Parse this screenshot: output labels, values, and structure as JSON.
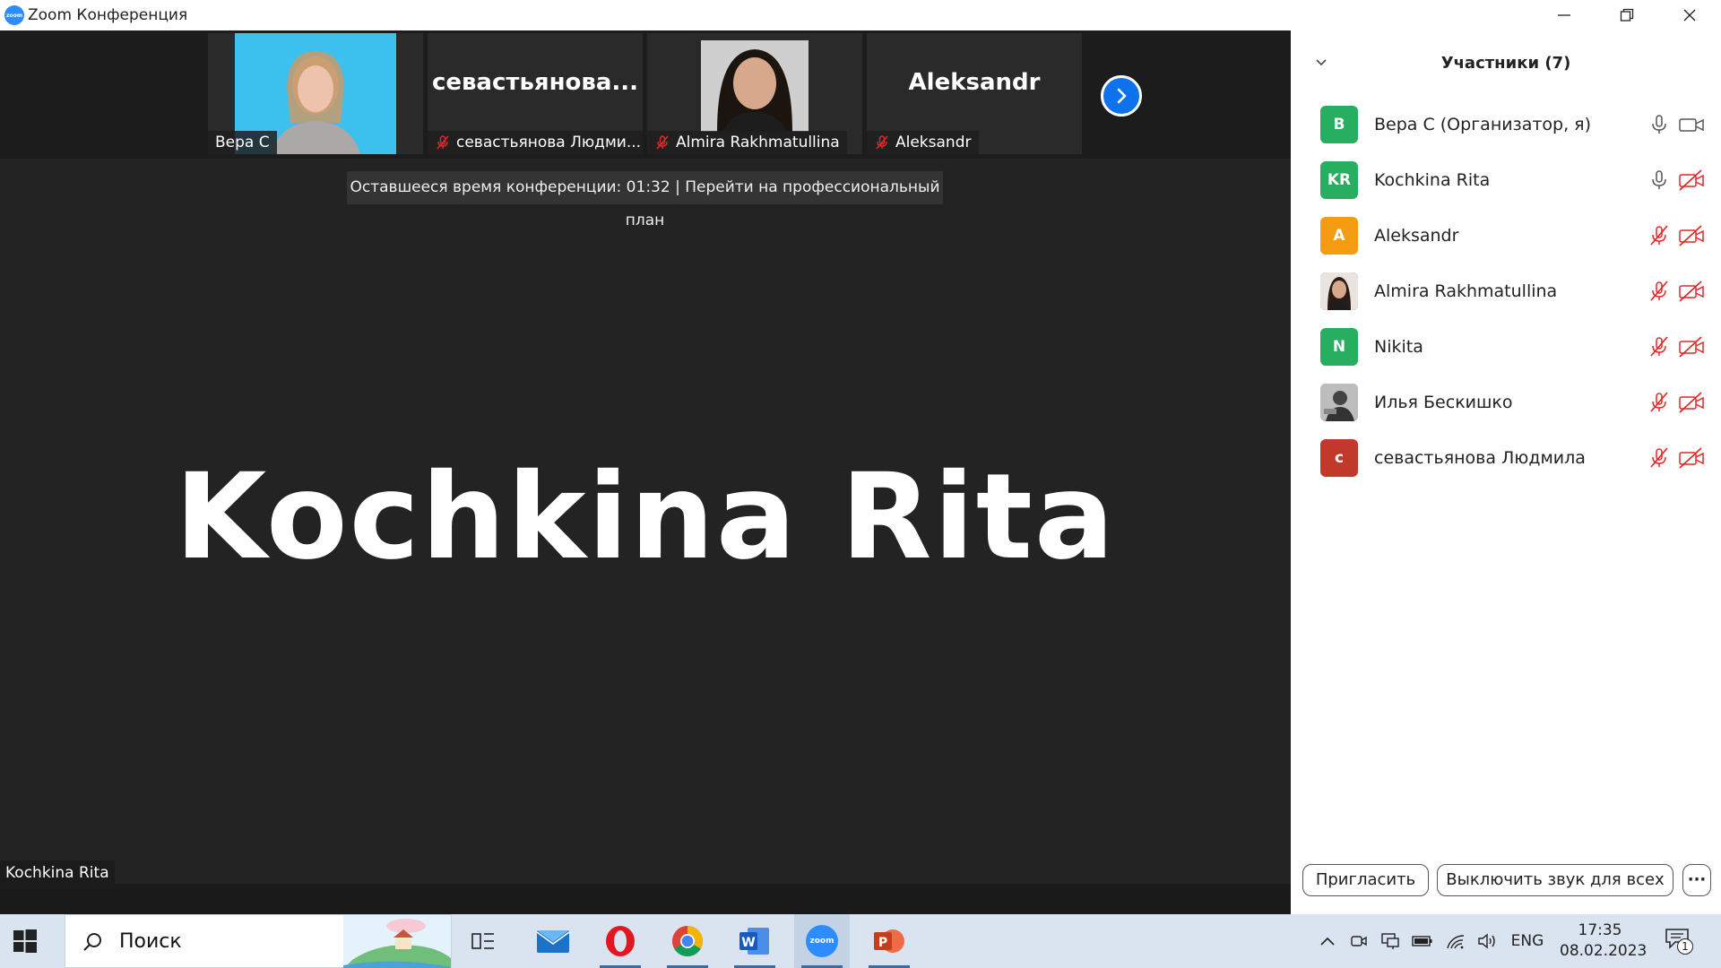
{
  "window": {
    "logo_text": "zoom",
    "title": "Zoom Конференция"
  },
  "thumbnails": [
    {
      "name": "Вера С",
      "big_label": "",
      "muted": false
    },
    {
      "name": "севастьянова Людми...",
      "big_label": "севастьянова...",
      "muted": true
    },
    {
      "name": "Almira Rakhmatullina",
      "big_label": "",
      "muted": true
    },
    {
      "name": "Aleksandr",
      "big_label": "Aleksandr",
      "muted": true
    }
  ],
  "banner": "Оставшееся время конференции: 01:32 | Перейти на профессиональный план",
  "active_speaker": {
    "big_name": "Kochkina Rita",
    "label": "Kochkina Rita"
  },
  "participants_panel": {
    "title": "Участники (7)",
    "participants": [
      {
        "initials": "В",
        "name": "Вера С (Организатор, я)",
        "color": "#27AE60",
        "mic": "on",
        "video": "on"
      },
      {
        "initials": "KR",
        "name": "Kochkina Rita",
        "color": "#27AE60",
        "mic": "on",
        "video": "off"
      },
      {
        "initials": "A",
        "name": "Aleksandr",
        "color": "#F39C12",
        "mic": "off",
        "video": "off"
      },
      {
        "initials": "",
        "name": "Almira Rakhmatullina",
        "color": "#3a2a22",
        "mic": "off",
        "video": "off"
      },
      {
        "initials": "N",
        "name": "Nikita",
        "color": "#27AE60",
        "mic": "off",
        "video": "off"
      },
      {
        "initials": "",
        "name": "Илья Бескишко",
        "color": "#555555",
        "mic": "off",
        "video": "off"
      },
      {
        "initials": "с",
        "name": "севастьянова Людмила",
        "color": "#C0392B",
        "mic": "off",
        "video": "off"
      }
    ],
    "invite_label": "Пригласить",
    "mute_all_label": "Выключить звук для всех",
    "more_label": "···"
  },
  "taskbar": {
    "search_placeholder": "Поиск",
    "apps": [
      "task-view",
      "mail",
      "opera",
      "chrome",
      "word",
      "zoom",
      "powerpoint"
    ],
    "zoom_label": "zoom",
    "language": "ENG",
    "time": "17:35",
    "date": "08.02.2023",
    "notification_count": "1"
  },
  "colors": {
    "accent": "#0E72ED",
    "muted_red": "#E02828",
    "video_bg": "#232323"
  }
}
